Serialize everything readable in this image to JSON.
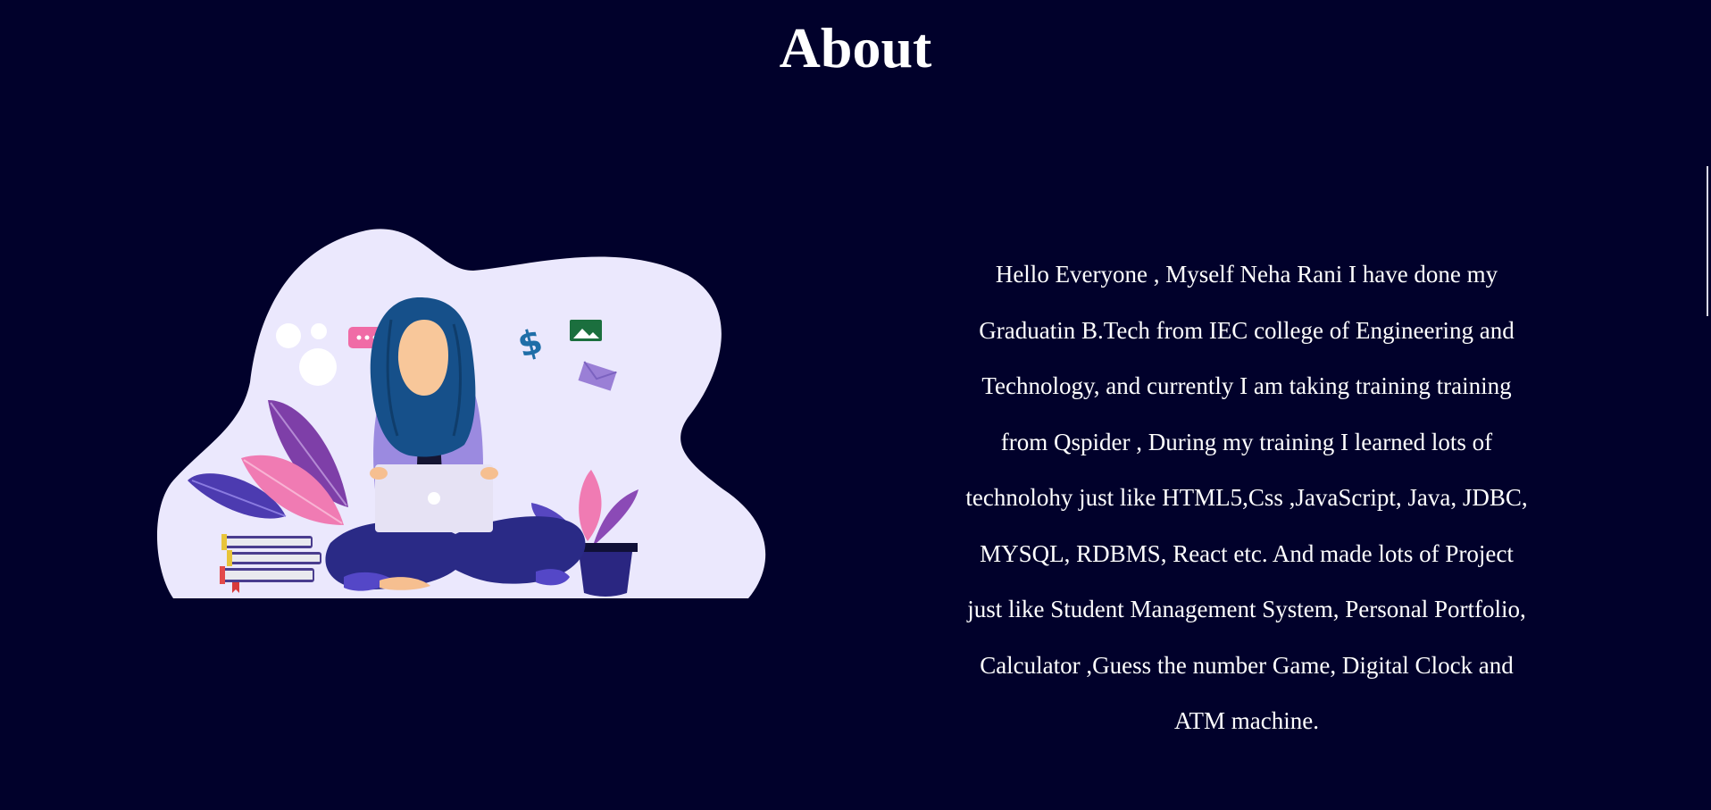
{
  "section": {
    "title": "About",
    "paragraph": "Hello Everyone , Myself Neha Rani I have done my Graduatin B.Tech from IEC college of Engineering and Technology, and currently I am taking training training from Qspider , During my training I learned lots of technolohy just like HTML5,Css ,JavaScript, Java, JDBC, MYSQL, RDBMS, React etc. And made lots of Project just like Student Management System, Personal Portfolio, Calculator ,Guess the number Game, Digital Clock and ATM machine."
  },
  "illustration": {
    "icon": "woman-working-on-laptop-illustration"
  },
  "colors": {
    "background": "#01012b",
    "text": "#ffffff",
    "blob": "#ebe8fd",
    "accent_purple": "#6c4fc1",
    "accent_pink": "#f07bb3",
    "hair": "#16508a"
  }
}
